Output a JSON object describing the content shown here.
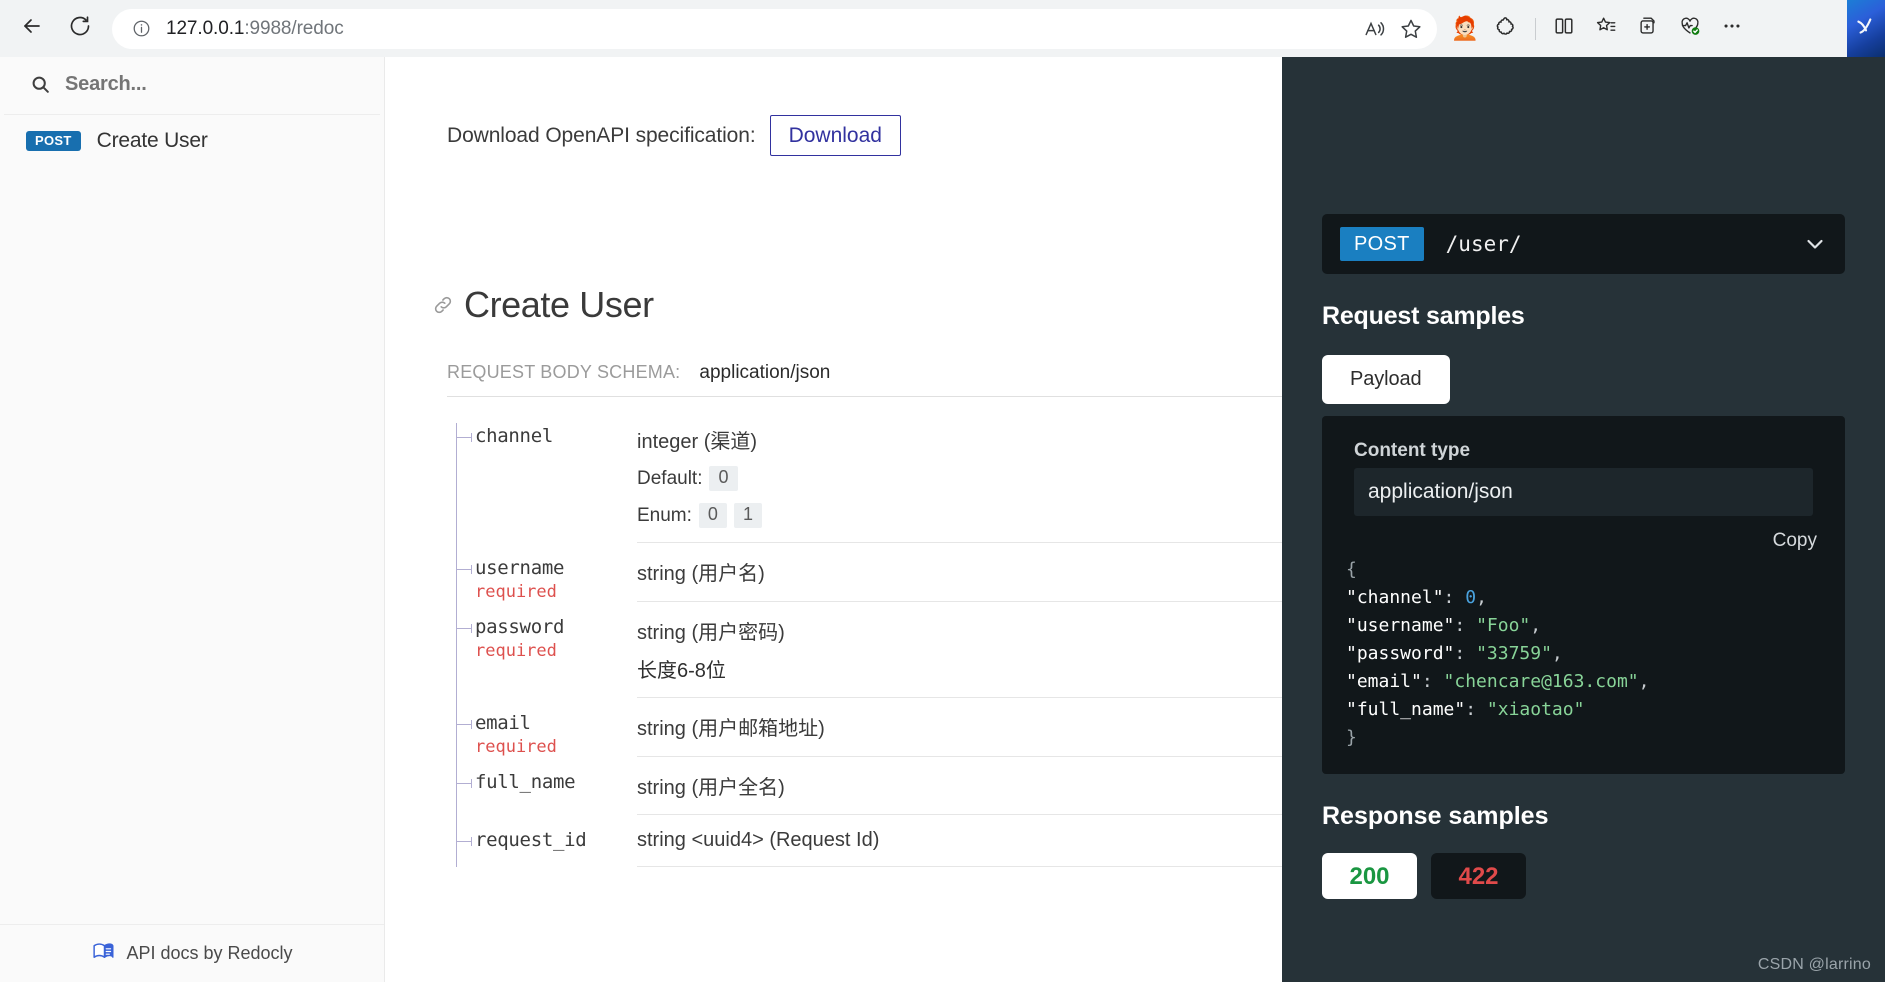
{
  "browser": {
    "back_icon": "back-arrow-icon",
    "reload_icon": "reload-icon",
    "info_icon": "site-info-icon",
    "url": "127.0.0.1:9988/redoc",
    "url_host": "127.0.0.1",
    "url_path": ":9988/redoc",
    "read_aloud_icon": "read-aloud-icon",
    "favorite_icon": "favorite-star-icon",
    "profile_icon": "profile-avatar-icon",
    "extensions_icon": "extensions-puzzle-icon",
    "split_screen_icon": "split-screen-icon",
    "collections_icon": "collections-star-icon",
    "add_tab_group_icon": "add-tab-group-icon",
    "browser_essentials_icon": "browser-essentials-icon",
    "settings_more_icon": "settings-and-more-icon",
    "copilot_icon": "copilot-icon"
  },
  "sidebar": {
    "search": {
      "placeholder": "Search...",
      "value": "",
      "icon": "search-icon"
    },
    "items": [
      {
        "method": "POST",
        "label": "Create User"
      }
    ],
    "footer": {
      "label": "API docs by Redocly",
      "icon": "redocly-logo-icon"
    }
  },
  "doc": {
    "download": {
      "label": "Download OpenAPI specification:",
      "button": "Download"
    },
    "heading": "Create User",
    "heading_anchor_icon": "link-anchor-icon",
    "schema": {
      "label": "REQUEST BODY SCHEMA:",
      "value": "application/json"
    },
    "fields": [
      {
        "name": "channel",
        "required": "",
        "type": "integer (渠道)",
        "default_label": "Default:",
        "default_value": "0",
        "enum_label": "Enum:",
        "enum_values": [
          "0",
          "1"
        ],
        "sub": ""
      },
      {
        "name": "username",
        "required": "required",
        "type": "string (用户名)",
        "sub": ""
      },
      {
        "name": "password",
        "required": "required",
        "type": "string (用户密码)",
        "sub": "长度6-8位"
      },
      {
        "name": "email",
        "required": "required",
        "type": "string (用户邮箱地址)",
        "sub": ""
      },
      {
        "name": "full_name",
        "required": "",
        "type": "string (用户全名)",
        "sub": ""
      },
      {
        "name": "request_id",
        "required": "",
        "type": "string <uuid4> (Request Id)",
        "sub": ""
      }
    ]
  },
  "right_panel": {
    "endpoint": {
      "method": "POST",
      "path": "/user/",
      "chevron_icon": "chevron-down-icon"
    },
    "request_samples_title": "Request samples",
    "payload_tab": "Payload",
    "content_type_label": "Content type",
    "content_type_value": "application/json",
    "copy_label": "Copy",
    "code": {
      "open_brace": "{",
      "close_brace": "}",
      "lines": [
        {
          "key": "\"channel\"",
          "sep": ": ",
          "value": "0",
          "kind": "num",
          "comma": ","
        },
        {
          "key": "\"username\"",
          "sep": ": ",
          "value": "\"Foo\"",
          "kind": "str",
          "comma": ","
        },
        {
          "key": "\"password\"",
          "sep": ": ",
          "value": "\"33759\"",
          "kind": "str",
          "comma": ","
        },
        {
          "key": "\"email\"",
          "sep": ": ",
          "value": "\"chencare@163.com\"",
          "kind": "str",
          "comma": ","
        },
        {
          "key": "\"full_name\"",
          "sep": ": ",
          "value": "\"xiaotao\"",
          "kind": "str",
          "comma": ""
        }
      ]
    },
    "response_samples_title": "Response samples",
    "response_tabs": [
      {
        "code": "200",
        "status": "ok"
      },
      {
        "code": "422",
        "status": "err"
      }
    ]
  },
  "watermark": "CSDN @larrino",
  "colors": {
    "accent_blue": "#186faf",
    "panel_dark": "#263238",
    "code_dark": "#11171a",
    "required_red": "#d41f1c",
    "download_purple": "#32329f",
    "string_green": "#88d498",
    "number_blue": "#4aa3df",
    "ok_green": "#1a9641",
    "err_red": "#e04a4a"
  }
}
